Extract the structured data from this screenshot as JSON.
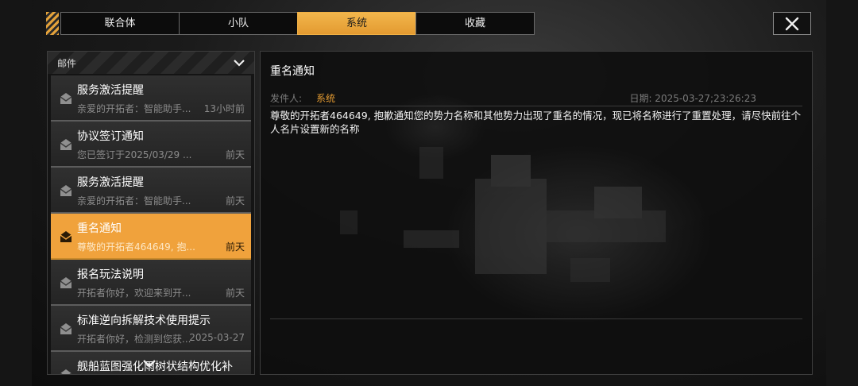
{
  "tabs": [
    {
      "label": "联合体",
      "active": false
    },
    {
      "label": "小队",
      "active": false
    },
    {
      "label": "系统",
      "active": true
    },
    {
      "label": "收藏",
      "active": false
    }
  ],
  "close_icon": "close-icon",
  "mail_panel": {
    "header": "邮件",
    "items": [
      {
        "title": "服务激活提醒",
        "preview": "亲爱的开拓者：智能助手...",
        "time": "13小时前",
        "active": false
      },
      {
        "title": "协议签订通知",
        "preview": "您已签订于2025/03/29 ...",
        "time": "前天",
        "active": false
      },
      {
        "title": "服务激活提醒",
        "preview": "亲爱的开拓者：智能助手...",
        "time": "前天",
        "active": false
      },
      {
        "title": "重名通知",
        "preview": "尊敬的开拓者464649, 抱...",
        "time": "前天",
        "active": true
      },
      {
        "title": "报名玩法说明",
        "preview": "开拓者你好，欢迎来到开...",
        "time": "前天",
        "active": false
      },
      {
        "title": "标准逆向拆解技术使用提示",
        "preview": "开拓者你好，检测到您获...",
        "time": "2025-03-27",
        "active": false
      },
      {
        "title": "舰船蓝图强化雨树状结构优化补",
        "preview": "",
        "time": "",
        "active": false
      }
    ]
  },
  "detail": {
    "title": "重名通知",
    "sender_label": "发件人:",
    "sender": "系统",
    "date": "日期: 2025-03-27;23:26:23",
    "body": "尊敬的开拓者464649, 抱歉通知您的势力名称和其他势力出现了重名的情况，现已将名称进行了重置处理，请尽快前往个人名片设置新的名称"
  },
  "colors": {
    "accent": "#f0a23c",
    "sender": "#e39a31"
  }
}
